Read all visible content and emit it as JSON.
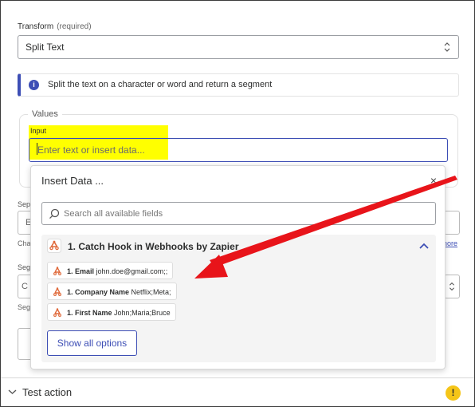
{
  "transform": {
    "label": "Transform",
    "required": "(required)",
    "value": "Split Text"
  },
  "info": {
    "text": "Split the text on a character or word and return a segment"
  },
  "values": {
    "legend": "Values",
    "input_label": "Input",
    "input_placeholder": "Enter text or insert data..."
  },
  "background": {
    "field2_label": "Sep",
    "field2_value": "E",
    "field2_help": "Cha",
    "more_link": "nore",
    "field3_label": "Seg",
    "field3_value": "C",
    "field3_help": "Seg"
  },
  "insert_data": {
    "title": "Insert Data ...",
    "close": "×",
    "search_placeholder": "Search all available fields",
    "group_title": "1. Catch Hook in Webhooks by Zapier",
    "fields": [
      {
        "name": "1. Email",
        "value": "john.doe@gmail.com;;"
      },
      {
        "name": "1. Company Name",
        "value": "Netflix;Meta;"
      },
      {
        "name": "1. First Name",
        "value": "John;Maria;Bruce"
      }
    ],
    "show_all": "Show all options"
  },
  "footer": {
    "test_action": "Test action",
    "warning": "!"
  },
  "colors": {
    "accent": "#3d4eb5",
    "highlight": "#ffff00",
    "arrow": "#e8141a",
    "webhook_icon": "#e06a3b"
  },
  "icons": [
    "chevron-updown-icon",
    "info-icon",
    "close-icon",
    "search-icon",
    "webhook-icon",
    "chevron-up-icon",
    "chevron-down-icon",
    "warning-icon"
  ]
}
